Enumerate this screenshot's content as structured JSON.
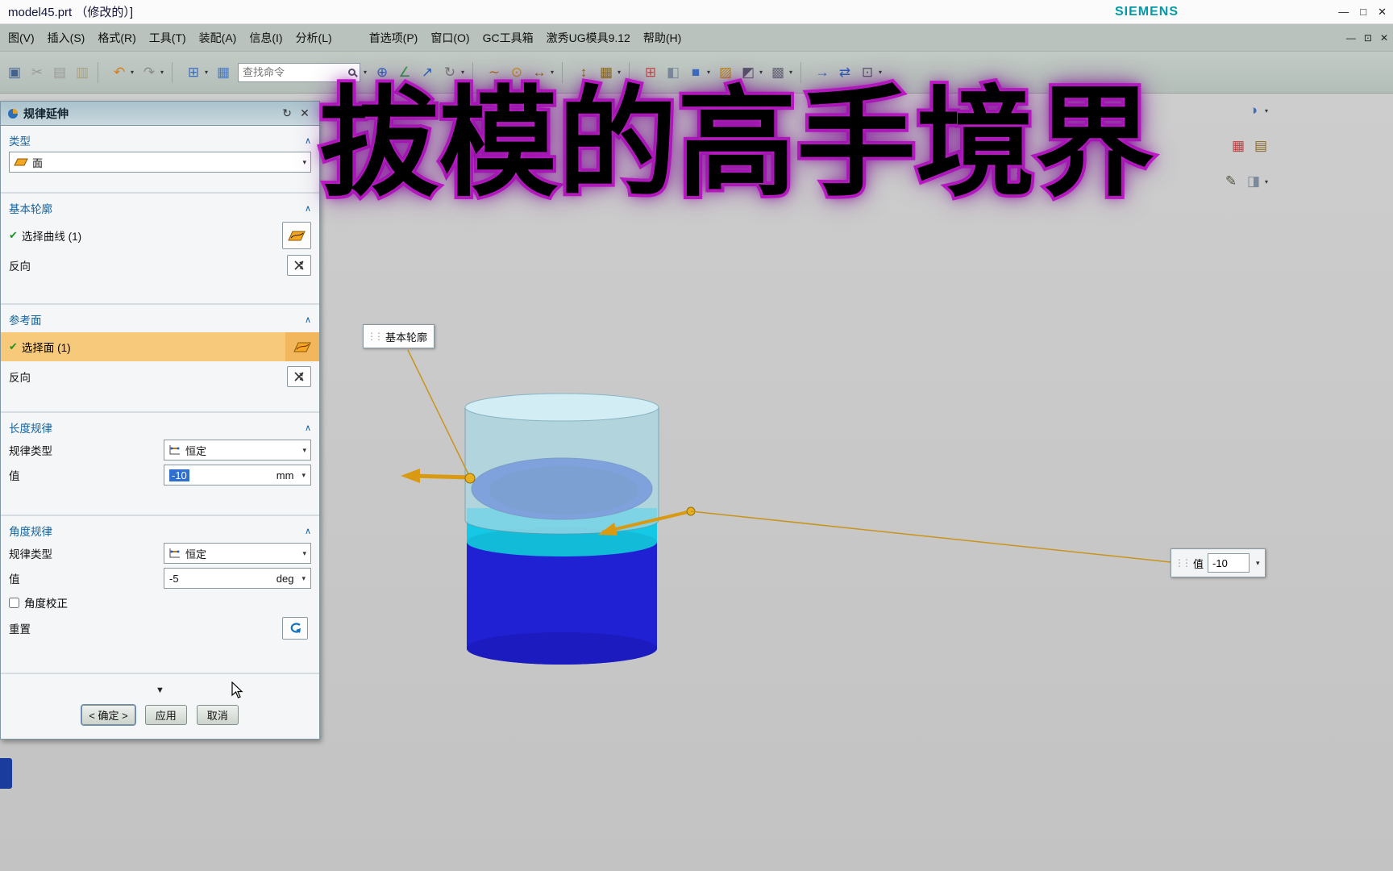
{
  "window": {
    "title": "model45.prt  （修改的）]",
    "brand": "SIEMENS",
    "controls": [
      "—",
      "□",
      "✕"
    ]
  },
  "menubar": {
    "items": [
      "图(V)",
      "插入(S)",
      "格式(R)",
      "工具(T)",
      "装配(A)",
      "信息(I)",
      "分析(L)",
      "首选项(P)",
      "窗口(O)",
      "GC工具箱",
      "激秀UG模具9.12",
      "帮助(H)"
    ],
    "controls": [
      "—",
      "⊡",
      "✕"
    ]
  },
  "toolbar": {
    "search_placeholder": "查找命令",
    "icons_left": [
      {
        "name": "save",
        "glyph": "▣",
        "color": "#44618e"
      },
      {
        "name": "cut",
        "glyph": "✂",
        "color": "#9a9a9a"
      },
      {
        "name": "copy",
        "glyph": "▤",
        "color": "#9a9a9a"
      },
      {
        "name": "paste",
        "glyph": "▥",
        "color": "#a8a183"
      },
      {
        "sep": true
      },
      {
        "name": "undo",
        "glyph": "↶",
        "color": "#d97b16",
        "caret": true
      },
      {
        "name": "redo",
        "glyph": "↷",
        "color": "#8a8a8a",
        "caret": true
      },
      {
        "sep": true
      },
      {
        "name": "window-layout",
        "glyph": "⊞",
        "color": "#3a6ec0",
        "caret": true
      },
      {
        "name": "export-sheet",
        "glyph": "▦",
        "color": "#4a7ac0"
      }
    ],
    "icons_right": [
      {
        "name": "datum-point",
        "glyph": "⊕",
        "color": "#2b5fb8"
      },
      {
        "name": "datum-csys",
        "glyph": "∠",
        "color": "#2b9a3e"
      },
      {
        "name": "vector",
        "glyph": "↗",
        "color": "#2b5fb8"
      },
      {
        "name": "csys-rotate",
        "glyph": "↻",
        "color": "#777777",
        "caret": true
      },
      {
        "sep": true
      },
      {
        "name": "spline",
        "glyph": "∼",
        "color": "#b06a10"
      },
      {
        "name": "key",
        "glyph": "⊙",
        "color": "#c8920a"
      },
      {
        "name": "measure",
        "glyph": "↔",
        "color": "#8a6a10",
        "caret": true
      },
      {
        "sep": true
      },
      {
        "name": "dimension",
        "glyph": "↕",
        "color": "#8a6a10"
      },
      {
        "name": "grid",
        "glyph": "▦",
        "color": "#8a6a10",
        "caret": true
      },
      {
        "sep": true
      },
      {
        "name": "pattern",
        "glyph": "⊞",
        "color": "#c04a4a"
      },
      {
        "name": "shell",
        "glyph": "◧",
        "color": "#7a8a9a"
      },
      {
        "name": "block",
        "glyph": "■",
        "color": "#3a6ec0",
        "caret": true
      },
      {
        "name": "sheet-body",
        "glyph": "▨",
        "color": "#b8860b"
      },
      {
        "name": "section-view",
        "glyph": "◩",
        "color": "#555566",
        "caret": true
      },
      {
        "name": "shaded-view",
        "glyph": "▩",
        "color": "#666677",
        "caret": true
      },
      {
        "sep": true
      },
      {
        "name": "move-face",
        "glyph": "→",
        "color": "#2b5fb8"
      },
      {
        "name": "sync-modeling",
        "glyph": "⇄",
        "color": "#2b5fb8"
      },
      {
        "name": "more-tools",
        "glyph": "⊡",
        "color": "#555566",
        "caret": true
      }
    ]
  },
  "dialog": {
    "title": "规律延伸",
    "type": {
      "label": "类型",
      "value": "面"
    },
    "base_profile": {
      "label": "基本轮廓",
      "select": "选择曲线 (1)",
      "reverse": "反向"
    },
    "reference": {
      "label": "参考面",
      "select": "选择面 (1)",
      "reverse": "反向"
    },
    "length_law": {
      "label": "长度规律",
      "type_label": "规律类型",
      "type_value": "恒定",
      "value_label": "值",
      "value": "-10",
      "unit": "mm"
    },
    "angle_law": {
      "label": "角度规律",
      "type_label": "规律类型",
      "type_value": "恒定",
      "value_label": "值",
      "value": "-5",
      "unit": "deg",
      "correction": "角度校正",
      "reset": "重置"
    },
    "buttons": {
      "ok": "< 确定 >",
      "apply": "应用",
      "cancel": "取消"
    }
  },
  "viewport": {
    "profile_tag": "基本轮廓",
    "floating": {
      "label": "值",
      "value": "-10"
    },
    "dock": [
      [
        {
          "name": "display-mode",
          "glyph": "◑",
          "color": "#3a6ec0",
          "caret": true
        }
      ],
      [
        {
          "name": "sheet-red",
          "glyph": "▦",
          "color": "#c04040"
        },
        {
          "name": "book",
          "glyph": "▤",
          "color": "#8a6a2a"
        }
      ],
      [
        {
          "name": "annotate-pencil",
          "glyph": "✎",
          "color": "#555544"
        },
        {
          "name": "palette",
          "glyph": "◨",
          "color": "#7a8a9a",
          "caret": true
        }
      ]
    ]
  },
  "overlay": {
    "title": "拔模的高手境界"
  },
  "glyphs": {
    "caret": "▾",
    "chevron": "∧",
    "check": "✔",
    "close": "✕",
    "reset": "↻",
    "more": "▼",
    "grip": "⋮⋮"
  },
  "colors": {
    "accent_orange": "#f7c97b",
    "selection_blue": "#2f6fd0",
    "model_blue": "#2121d4",
    "model_cyan": "#14c8e6",
    "handle_gold": "#d99a12",
    "headline_magenta": "#cf1fd4"
  }
}
